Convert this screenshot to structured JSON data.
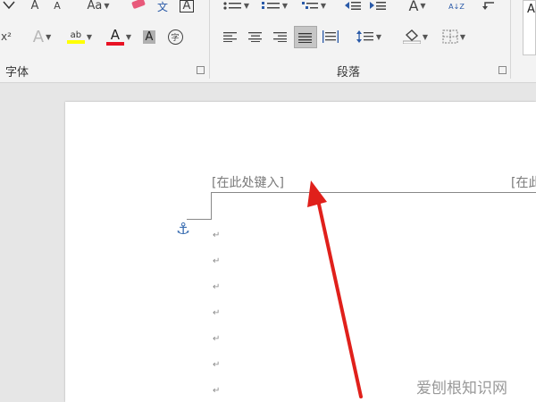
{
  "ribbon": {
    "font_group": {
      "label": "字体",
      "grow_font": "A",
      "shrink_font": "A",
      "change_case": "Aa",
      "phonetic": "文",
      "char_border": "A",
      "text_effects": "A",
      "highlight_text": "ab",
      "font_color": "A",
      "char_shading": "A",
      "enclose_char": "字",
      "superscript": "x²"
    },
    "paragraph_group": {
      "label": "段落",
      "sort": "A↓Z"
    },
    "styles_preview": "A"
  },
  "document": {
    "header_placeholder_left": "[在此处键入]",
    "header_placeholder_right": "[在此",
    "paragraph_mark": "↵",
    "paragraph_count": 7
  },
  "watermark": "爱刨根知识网",
  "colors": {
    "highlight": "#ffff00",
    "font_color": "#e81123",
    "arrow": "#e0201b",
    "anchor": "#3c6fb2"
  }
}
